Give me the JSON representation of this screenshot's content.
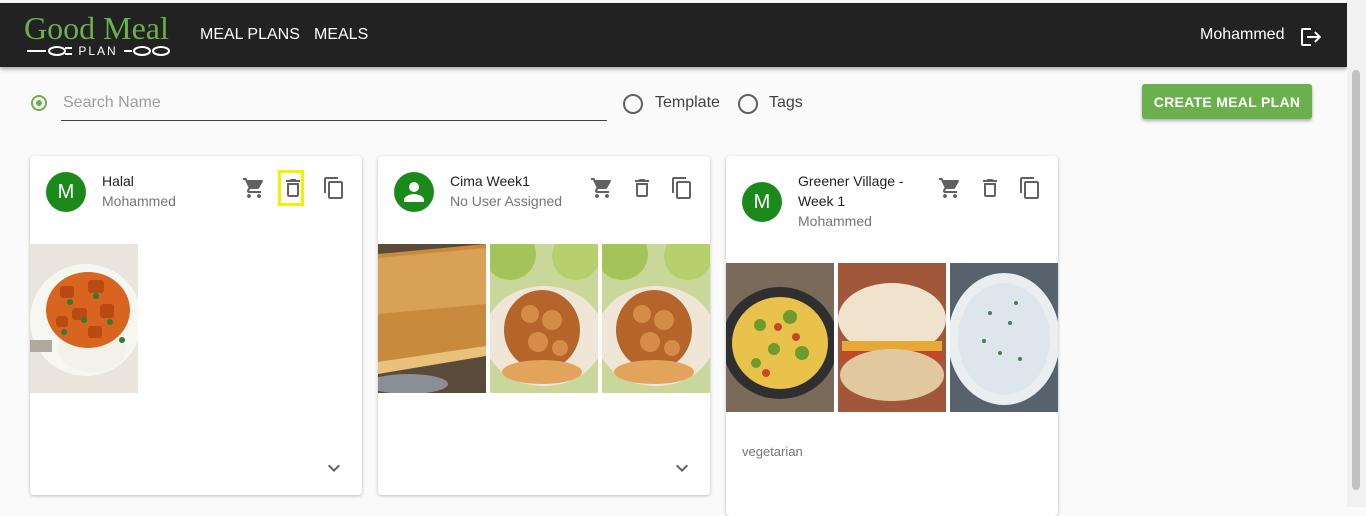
{
  "header": {
    "logo_text": "Good Meal",
    "logo_sub": "PLAN",
    "nav": [
      "MEAL PLANS",
      "MEALS"
    ],
    "user_name": "Mohammed"
  },
  "filters": {
    "search_placeholder": "Search Name",
    "search_value": "",
    "options": [
      "Template",
      "Tags"
    ],
    "create_label": "CREATE MEAL PLAN"
  },
  "colors": {
    "brand": "#6ab04c",
    "topbar": "#222222",
    "avatar": "#1b8a1b",
    "highlight": "#f5ef00"
  },
  "cards": [
    {
      "title": "Halal",
      "subtitle": "Mohammed",
      "avatar": "M",
      "avatar_icon": "letter",
      "tag": "",
      "images": [
        "curry-chicken-rice"
      ]
    },
    {
      "title": "Cima Week1",
      "subtitle": "No User Assigned",
      "avatar": "",
      "avatar_icon": "person-icon",
      "tag": "",
      "images": [
        "oat-bar",
        "apple-crumble",
        "apple-crumble"
      ]
    },
    {
      "title": "Greener Village - Week 1",
      "title_line1": "Greener Village -",
      "title_line2": "Week 1",
      "subtitle": "Mohammed",
      "avatar": "M",
      "avatar_icon": "letter",
      "tag": "vegetarian",
      "images": [
        "frittata",
        "breakfast-muffin",
        "herb-dip"
      ]
    }
  ]
}
